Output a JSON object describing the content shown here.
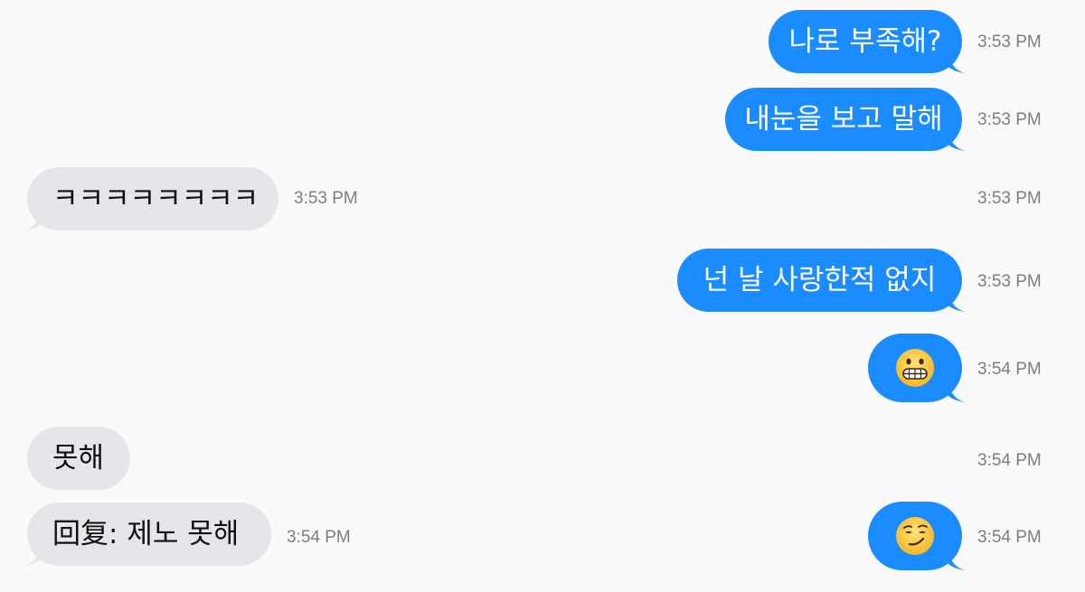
{
  "messages": [
    {
      "side": "out",
      "text": "나로 부족해?",
      "time": "3:53 PM"
    },
    {
      "side": "out",
      "text": "내눈을 보고 말해",
      "time": "3:53 PM"
    },
    {
      "side": "in",
      "text": "ㅋㅋㅋㅋㅋㅋㅋㅋ",
      "time": "3:53 PM",
      "right_time": "3:53 PM"
    },
    {
      "side": "out",
      "text": "넌 날 사랑한적 없지",
      "time": "3:53 PM"
    },
    {
      "side": "out",
      "emoji": "grimacing-face",
      "time": "3:54 PM"
    },
    {
      "side": "in",
      "text": "못해",
      "right_time": "3:54 PM"
    },
    {
      "side": "in",
      "text": "回复: 제노 못해",
      "time": "3:54 PM"
    },
    {
      "side": "out",
      "emoji": "smirking-face",
      "time": "3:54 PM"
    }
  ],
  "colors": {
    "outgoing_bubble": "#1a8cff",
    "incoming_bubble": "#e5e5ea",
    "timestamp": "#7d7d82",
    "background": "#fafafa"
  }
}
